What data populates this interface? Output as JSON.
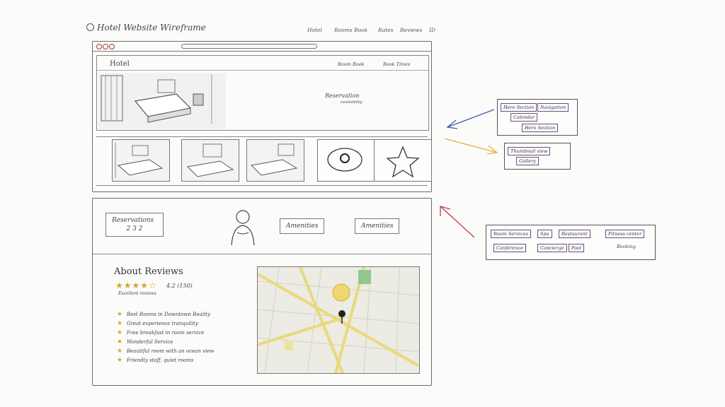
{
  "header": {
    "title": "Hotel Website Wireframe",
    "nav": [
      "Hotel",
      "Rooms Book",
      "Rates",
      "Reviews",
      "ID"
    ]
  },
  "hero": {
    "brand": "Hotel",
    "nav_right_1": "Room Book",
    "nav_right_2": "Book Times",
    "tagline": "Reservation",
    "tagline_sub": "availability"
  },
  "booking_strip": {
    "box1_title": "Reservations",
    "box1_value": "2 3 2",
    "box2_label": "Amenities",
    "box3_label": "Amenities"
  },
  "reviews": {
    "title": "About Reviews",
    "rating_text": "4.2 (150)",
    "rating_value": 4.2,
    "rating_sub": "Excellent reviews",
    "items": [
      "Best Rooms in Downtown Reality",
      "Great experience tranquility",
      "Free breakfast in room service",
      "Wonderful Service",
      "Beautiful room with an ocean view",
      "Friendly staff, quiet rooms"
    ]
  },
  "annotations": {
    "note1": [
      "Hero Section",
      "Navigation",
      "Calendar"
    ],
    "note2": [
      "Thumbnail view",
      "Gallery"
    ],
    "note3": [
      "Room Services",
      "Spa",
      "Restaurant",
      "Fitness center",
      "Conference",
      "Concierge",
      "Pool",
      "Booking"
    ]
  },
  "colors": {
    "arrow_blue": "#3b5ea8",
    "arrow_yellow": "#e0b33c",
    "arrow_red": "#b83a5a",
    "star": "#d4a72c",
    "map_road": "#e9d97a",
    "map_park": "#8fc98a"
  }
}
